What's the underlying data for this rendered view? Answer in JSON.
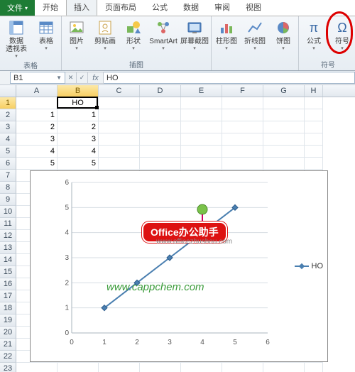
{
  "tabs": {
    "file": "文件",
    "items": [
      "开始",
      "插入",
      "页面布局",
      "公式",
      "数据",
      "审阅",
      "视图"
    ],
    "active_index": 1
  },
  "ribbon": {
    "groups": [
      {
        "label": "表格",
        "buttons": [
          {
            "name": "pivot-table",
            "label": "数据\n透视表",
            "icon": "pivot"
          },
          {
            "name": "table",
            "label": "表格",
            "icon": "table"
          }
        ]
      },
      {
        "label": "插图",
        "buttons": [
          {
            "name": "picture",
            "label": "图片",
            "icon": "picture"
          },
          {
            "name": "clipart",
            "label": "剪贴画",
            "icon": "clipart"
          },
          {
            "name": "shapes",
            "label": "形状",
            "icon": "shapes"
          },
          {
            "name": "smartart",
            "label": "SmartArt",
            "icon": "smartart"
          },
          {
            "name": "screenshot",
            "label": "屏幕截图",
            "icon": "screenshot"
          }
        ]
      },
      {
        "label": "",
        "buttons": [
          {
            "name": "column-chart",
            "label": "柱形图",
            "icon": "column"
          },
          {
            "name": "line-chart",
            "label": "折线图",
            "icon": "line"
          },
          {
            "name": "pie-chart",
            "label": "饼图",
            "icon": "pie"
          }
        ]
      },
      {
        "label": "符号",
        "buttons": [
          {
            "name": "equation",
            "label": "公式",
            "icon": "pi"
          },
          {
            "name": "symbol",
            "label": "符号",
            "icon": "omega"
          }
        ]
      }
    ]
  },
  "namebox": "B1",
  "formula": "HO",
  "columns": [
    "A",
    "B",
    "C",
    "D",
    "E",
    "F",
    "G",
    "H"
  ],
  "row_count": 23,
  "active_cell": {
    "row": 1,
    "col": "B"
  },
  "cells": {
    "B1": "HO",
    "A2": "1",
    "B2": "1",
    "A3": "2",
    "B3": "2",
    "A4": "3",
    "B4": "3",
    "A5": "4",
    "B5": "4",
    "A6": "5",
    "B6": "5"
  },
  "chart_data": {
    "type": "line",
    "series": [
      {
        "name": "HO",
        "x": [
          1,
          2,
          3,
          4,
          5
        ],
        "y": [
          1,
          2,
          3,
          4,
          5
        ]
      }
    ],
    "xlim": [
      0,
      6
    ],
    "ylim": [
      0,
      6
    ],
    "xticks": [
      0,
      1,
      2,
      3,
      4,
      5,
      6
    ],
    "yticks": [
      0,
      1,
      2,
      3,
      4,
      5,
      6
    ],
    "marker": "diamond",
    "line_color": "#4a7fb0"
  },
  "watermarks": {
    "badge": "Office办公助手",
    "badge_sub": "www.officezhushou.com",
    "green": "www.cappchem.com"
  }
}
